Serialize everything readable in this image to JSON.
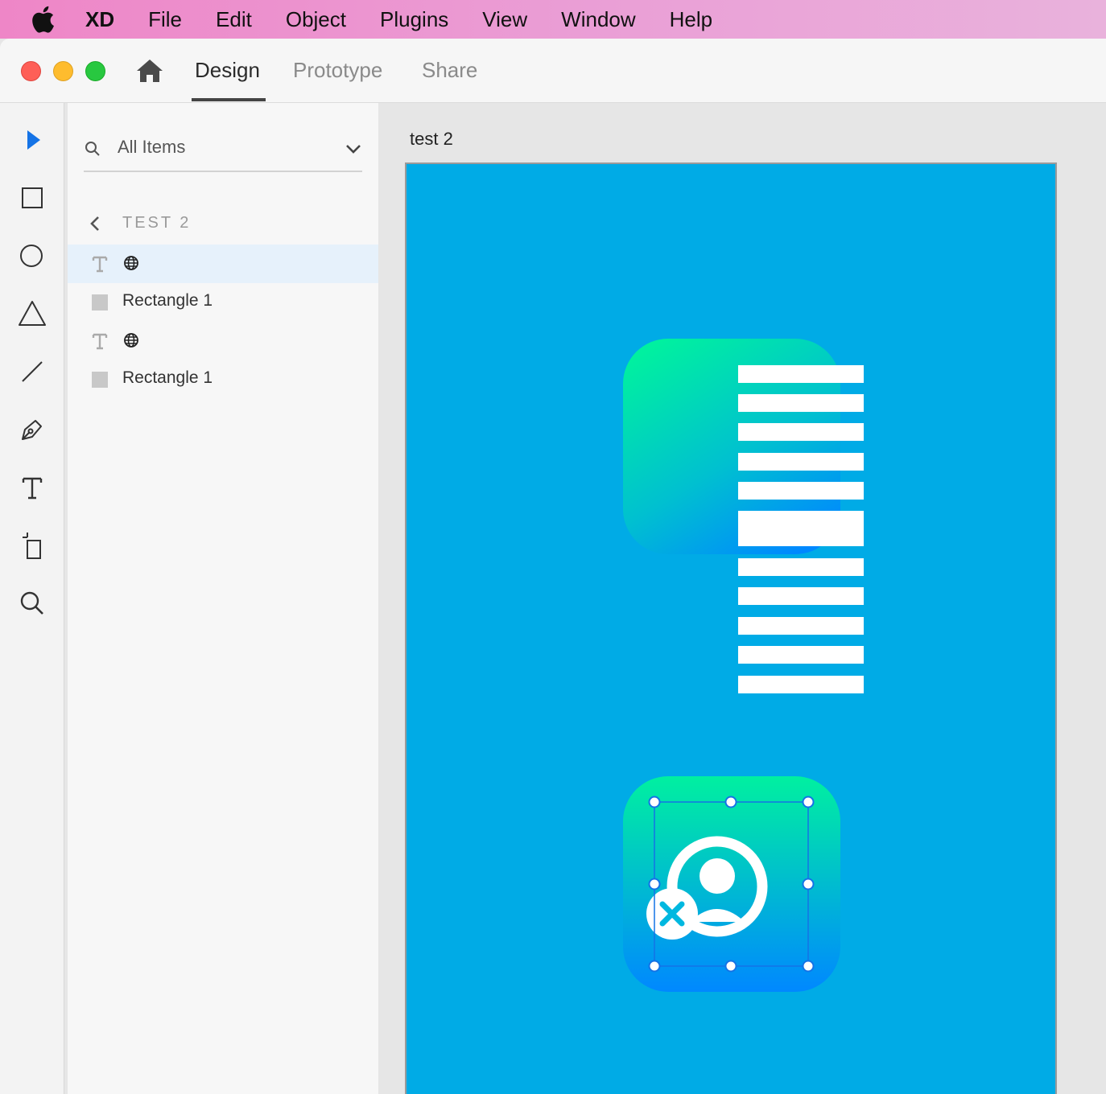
{
  "menubar": {
    "app": "XD",
    "items": [
      "File",
      "Edit",
      "Object",
      "Plugins",
      "View",
      "Window",
      "Help"
    ]
  },
  "tabs": {
    "design": "Design",
    "prototype": "Prototype",
    "share": "Share",
    "active": "Design"
  },
  "toolbar": {
    "tools": [
      "select-tool",
      "rectangle-tool",
      "ellipse-tool",
      "polygon-tool",
      "line-tool",
      "pen-tool",
      "text-tool",
      "artboard-tool",
      "zoom-tool"
    ],
    "active": "select-tool"
  },
  "layers": {
    "filter": "All Items",
    "breadcrumb": "TEST 2",
    "items": [
      {
        "type": "text",
        "name": "🌐",
        "icon": "text-icon",
        "selected": true
      },
      {
        "type": "rectangle",
        "name": "Rectangle 1",
        "icon": "rectangle-layer-icon",
        "selected": false
      },
      {
        "type": "text",
        "name": "🌐",
        "icon": "text-icon",
        "selected": false
      },
      {
        "type": "rectangle",
        "name": "Rectangle 1",
        "icon": "rectangle-layer-icon",
        "selected": false
      }
    ]
  },
  "canvas": {
    "artboard_name": "test 2"
  },
  "colors": {
    "artboard_fill": "#00abe6",
    "gradient_top": "#00f0a0",
    "gradient_bottom": "#0088ff",
    "selection": "#1473e6",
    "select_tool": "#1473e6"
  }
}
